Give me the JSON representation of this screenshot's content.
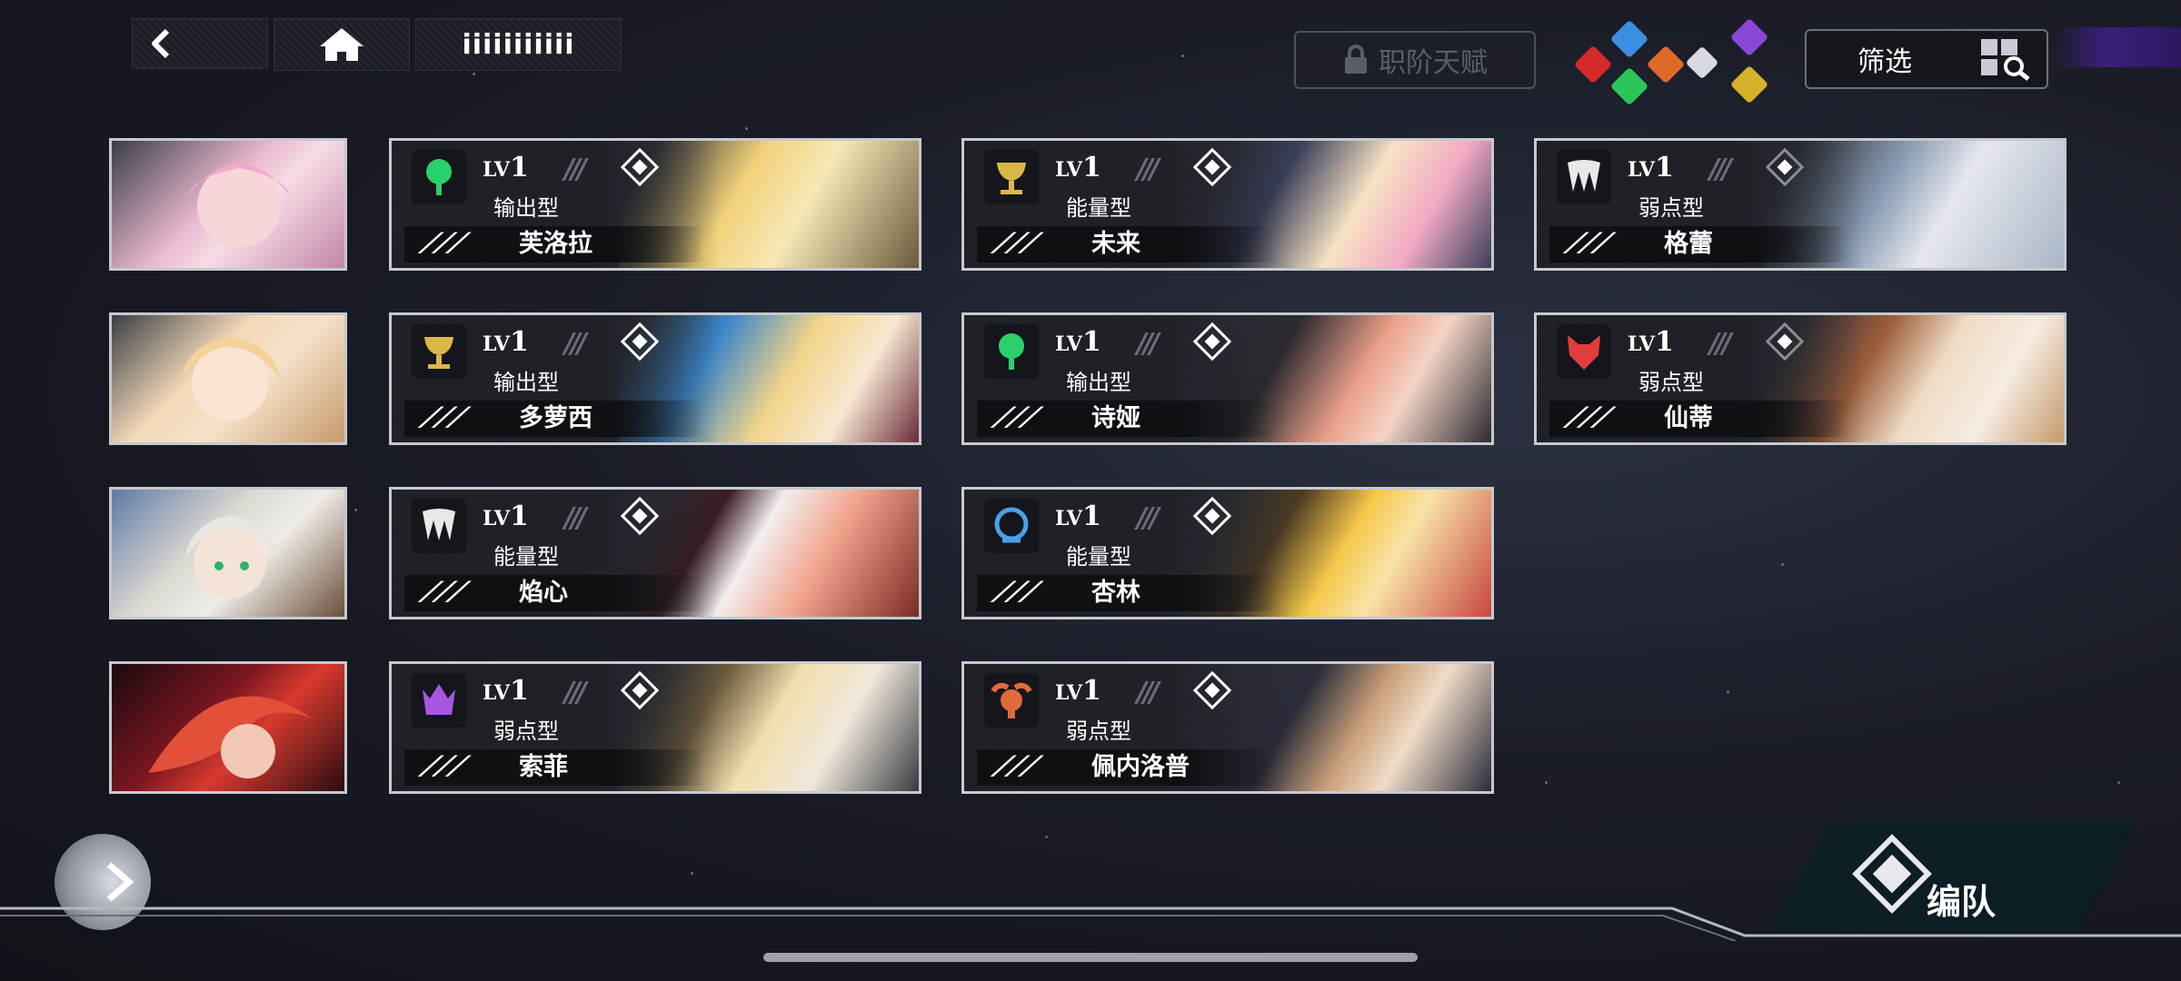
{
  "topnav": {
    "title": "iiiiiiiiiii"
  },
  "talent_button": {
    "label": "职阶天赋"
  },
  "filter_button": {
    "label": "筛选"
  },
  "element_gems": [
    "purple",
    "blue",
    "red",
    "orange",
    "green",
    "white",
    "gold"
  ],
  "small_cards": [
    {
      "color_a": "#f1b6d0",
      "color_b": "#d08fb0",
      "hair": "#f3a9c8"
    },
    {
      "color_a": "#f6d8b0",
      "color_b": "#e9b27d",
      "hair": "#f4d29a"
    },
    {
      "color_a": "#d8d4cf",
      "color_b": "#5d7aa8",
      "hair": "#e9e6e2"
    },
    {
      "color_a": "#d8392e",
      "color_b": "#3a0d12",
      "hair": "#e2503a"
    }
  ],
  "cards": [
    {
      "lv": "1",
      "type": "输出型",
      "name": "芙洛拉",
      "emblem_color": "#2ad06a",
      "emblem": "tree-icon",
      "diamond": "white",
      "art_a": "#f2d27a",
      "art_b": "#6b5a3c"
    },
    {
      "lv": "1",
      "type": "能量型",
      "name": "未来",
      "emblem_color": "#d9b84a",
      "emblem": "chalice-icon",
      "diamond": "white",
      "art_a": "#f7e3c4",
      "art_b": "#3a3e5a"
    },
    {
      "lv": "1",
      "type": "弱点型",
      "name": "格蕾",
      "emblem_color": "#e8e8e8",
      "emblem": "wings-icon",
      "diamond": "grey",
      "art_a": "#e6e8ee",
      "art_b": "#8a9cb4"
    },
    {
      "lv": "1",
      "type": "输出型",
      "name": "多萝西",
      "emblem_color": "#d9b84a",
      "emblem": "chalice-icon",
      "diamond": "white",
      "art_a": "#f3d58a",
      "art_b": "#3a86c8"
    },
    {
      "lv": "1",
      "type": "输出型",
      "name": "诗娅",
      "emblem_color": "#2ad06a",
      "emblem": "tree-icon",
      "diamond": "white",
      "art_a": "#eba08a",
      "art_b": "#2c2a30"
    },
    {
      "lv": "1",
      "type": "弱点型",
      "name": "仙蒂",
      "emblem_color": "#e23d3d",
      "emblem": "wolf-icon",
      "diamond": "grey",
      "art_a": "#f0dcc5",
      "art_b": "#9c5d3b"
    },
    {
      "lv": "1",
      "type": "能量型",
      "name": "焰心",
      "emblem_color": "#e8e8e8",
      "emblem": "wings-icon",
      "diamond": "white",
      "art_a": "#f1a68e",
      "art_b": "#f3eef0"
    },
    {
      "lv": "1",
      "type": "能量型",
      "name": "杏林",
      "emblem_color": "#4aa0e6",
      "emblem": "shield-icon",
      "diamond": "white",
      "art_a": "#f6c84a",
      "art_b": "#c7463e"
    },
    {
      "lv": "1",
      "type": "弱点型",
      "name": "索菲",
      "emblem_color": "#a856e0",
      "emblem": "crown-icon",
      "diamond": "white",
      "art_a": "#f3dfae",
      "art_b": "#efe8dc"
    },
    {
      "lv": "1",
      "type": "弱点型",
      "name": "佩内洛普",
      "emblem_color": "#e06a3a",
      "emblem": "ram-icon",
      "diamond": "white",
      "art_a": "#c9a07a",
      "art_b": "#2a2c3a"
    }
  ],
  "formation_button": {
    "label": "编队"
  }
}
